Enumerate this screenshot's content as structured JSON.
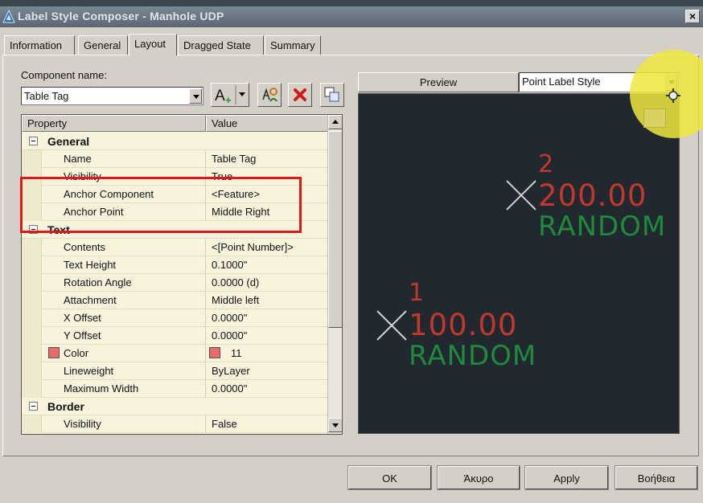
{
  "window": {
    "title": "Label Style Composer - Manhole UDP",
    "close_label": "×"
  },
  "tabs": [
    {
      "label": "Information"
    },
    {
      "label": "General"
    },
    {
      "label": "Layout",
      "active": true
    },
    {
      "label": "Dragged State"
    },
    {
      "label": "Summary"
    }
  ],
  "component": {
    "label": "Component name:",
    "value": "Table Tag"
  },
  "grid": {
    "header_property": "Property",
    "header_value": "Value",
    "rows": [
      {
        "type": "category",
        "name": "General"
      },
      {
        "name": "Name",
        "value": "Table Tag"
      },
      {
        "name": "Visibility",
        "value": "True"
      },
      {
        "name": "Anchor Component",
        "value": "<Feature>"
      },
      {
        "name": "Anchor Point",
        "value": "Middle Right"
      },
      {
        "type": "category",
        "name": "Text"
      },
      {
        "name": "Contents",
        "value": "<[Point Number]>"
      },
      {
        "name": "Text Height",
        "value": "0.1000\""
      },
      {
        "name": "Rotation Angle",
        "value": "0.0000 (d)"
      },
      {
        "name": "Attachment",
        "value": "Middle left"
      },
      {
        "name": "X Offset",
        "value": "0.0000\""
      },
      {
        "name": "Y Offset",
        "value": "0.0000\""
      },
      {
        "name": "Color",
        "value": "11",
        "swatch": "#e86a6a"
      },
      {
        "name": "Lineweight",
        "value": "ByLayer"
      },
      {
        "name": "Maximum Width",
        "value": "0.0000\""
      },
      {
        "type": "category",
        "name": "Border"
      },
      {
        "name": "Visibility",
        "value": "False"
      }
    ]
  },
  "preview": {
    "label": "Preview",
    "style_value": "Point Label Style",
    "points": [
      {
        "number": "2",
        "elevation": "200.00",
        "description": "RANDOM"
      },
      {
        "number": "1",
        "elevation": "100.00",
        "description": "RANDOM"
      }
    ]
  },
  "colors": {
    "label_red": "#c0392b",
    "label_green": "#1f8a3c",
    "marker": "#d0d0d0",
    "highlight": "#e01717"
  },
  "buttons": {
    "ok": "OK",
    "cancel": "Άκυρο",
    "apply": "Apply",
    "help": "Βοήθεια"
  }
}
